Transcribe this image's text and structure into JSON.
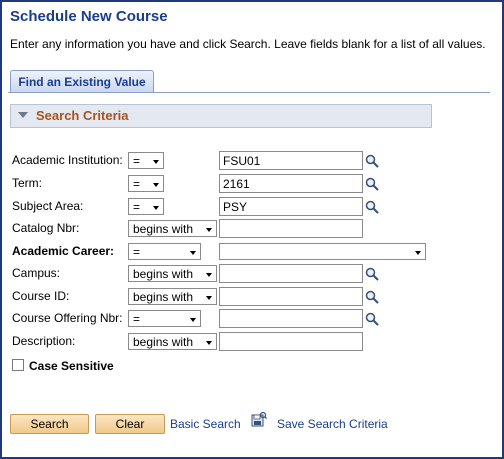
{
  "page": {
    "title": "Schedule New Course",
    "instructions": "Enter any information you have and click Search. Leave fields blank for a list of all values."
  },
  "tabs": [
    {
      "label": "Find an Existing Value"
    }
  ],
  "section": {
    "title": "Search Criteria"
  },
  "fields": {
    "academic_institution": {
      "label": "Academic Institution:",
      "operator": "=",
      "value": "FSU01"
    },
    "term": {
      "label": "Term:",
      "operator": "=",
      "value": "2161"
    },
    "subject_area": {
      "label": "Subject Area:",
      "operator": "=",
      "value": "PSY"
    },
    "catalog_nbr": {
      "label": "Catalog Nbr:",
      "operator": "begins with",
      "value": ""
    },
    "academic_career": {
      "label": "Academic Career:",
      "operator": "=",
      "value": ""
    },
    "campus": {
      "label": "Campus:",
      "operator": "begins with",
      "value": ""
    },
    "course_id": {
      "label": "Course ID:",
      "operator": "begins with",
      "value": ""
    },
    "course_offering_nbr": {
      "label": "Course Offering Nbr:",
      "operator": "=",
      "value": ""
    },
    "description": {
      "label": "Description:",
      "operator": "begins with",
      "value": ""
    }
  },
  "case_sensitive": {
    "label": "Case Sensitive",
    "checked": false
  },
  "actions": {
    "search_label": "Search",
    "clear_label": "Clear",
    "basic_search_label": "Basic Search",
    "save_search_label": "Save Search Criteria"
  },
  "icons": {
    "lookup": "magnifier-icon",
    "save": "save-search-icon",
    "collapse": "triangle-down-icon"
  },
  "colors": {
    "title": "#1a3d8f",
    "section_title": "#a8541e",
    "button_bg": "#f1c98a",
    "frame_border": "#1e3a7a"
  }
}
